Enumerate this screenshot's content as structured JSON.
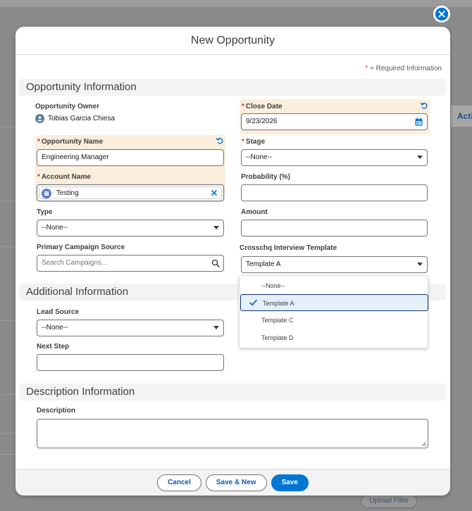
{
  "modal": {
    "title": "New Opportunity",
    "required_note": "= Required Information",
    "required_star": "*"
  },
  "sections": {
    "opportunity_information": "Opportunity Information",
    "additional_information": "Additional Information",
    "description_information": "Description Information"
  },
  "fields": {
    "opportunity_owner": {
      "label": "Opportunity Owner",
      "value": "Tobias Garcia Chiesa"
    },
    "close_date": {
      "label": "Close Date",
      "value": "9/23/2026"
    },
    "opportunity_name": {
      "label": "Opportunity Name",
      "value": "Engineering Manager"
    },
    "stage": {
      "label": "Stage",
      "value": "--None--"
    },
    "account_name": {
      "label": "Account Name",
      "value": "Testing"
    },
    "probability": {
      "label": "Probability (%)",
      "value": ""
    },
    "type": {
      "label": "Type",
      "value": "--None--"
    },
    "amount": {
      "label": "Amount",
      "value": ""
    },
    "primary_campaign_source": {
      "label": "Primary Campaign Source",
      "placeholder": "Search Campaigns..."
    },
    "crosschq_template": {
      "label": "Crosschq Interview Template",
      "value": "Template A"
    },
    "lead_source": {
      "label": "Lead Source",
      "value": "--None--"
    },
    "next_step": {
      "label": "Next Step",
      "value": ""
    },
    "description": {
      "label": "Description",
      "value": ""
    }
  },
  "template_dropdown": {
    "options": [
      "--None--",
      "Template A",
      "Template C",
      "Template D"
    ],
    "selected_index": 1
  },
  "footer": {
    "cancel": "Cancel",
    "save_new": "Save & New",
    "save": "Save"
  },
  "background": {
    "action_tab": "Acti",
    "upload_files": "Upload Files"
  },
  "colors": {
    "brand": "#0176d3",
    "required": "#c23934",
    "highlight": "#fbeedd",
    "selected_option": "#e5f0fb"
  }
}
